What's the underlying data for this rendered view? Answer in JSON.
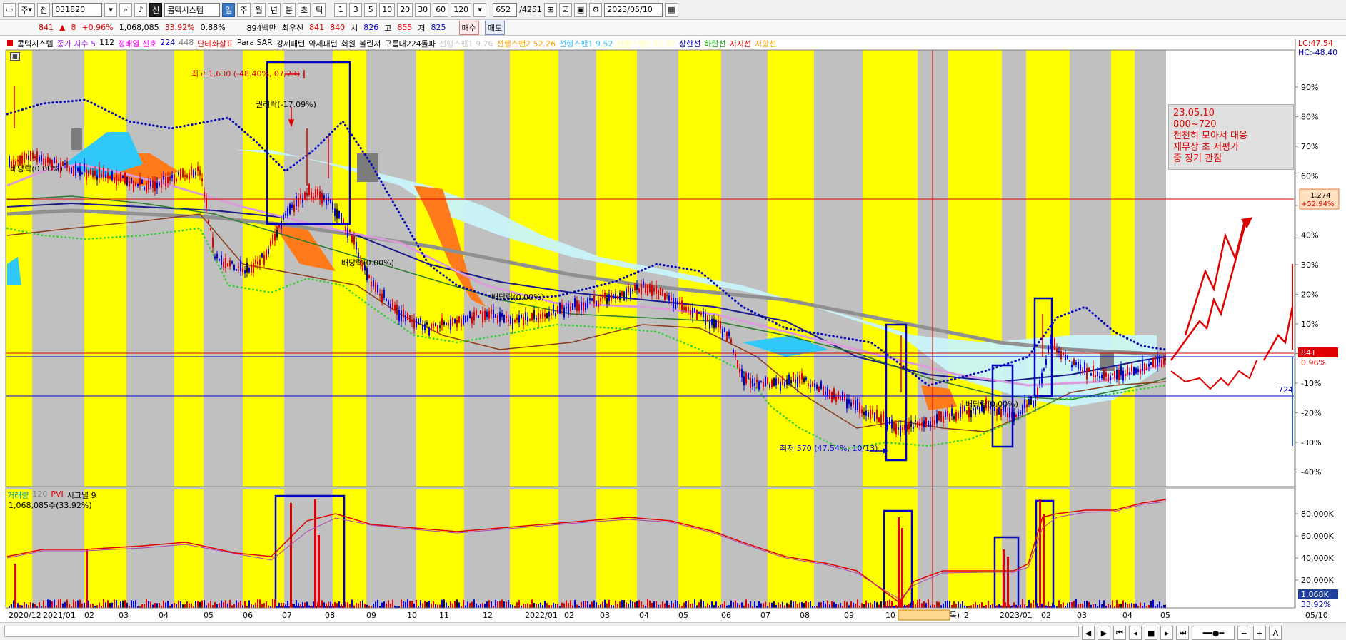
{
  "toolbar": {
    "period_type": "주",
    "jeon_label": "전",
    "code": "031820",
    "sin_label": "신",
    "stock_name": "콤텍시스템",
    "periods": [
      "일",
      "주",
      "월",
      "년",
      "분",
      "초",
      "틱"
    ],
    "active_period": "일",
    "numbers": [
      "1",
      "3",
      "5",
      "10",
      "20",
      "30",
      "60",
      "120"
    ],
    "count_value": "652",
    "count_total": "/4251",
    "date_value": "2023/05/10"
  },
  "quote": {
    "price": "841",
    "arrow": "▲",
    "change": "8",
    "change_pct": "+0.96%",
    "volume": "1,068,085",
    "vol_ratio": "33.92%",
    "turnover": "0.88%",
    "amount": "894백만",
    "best_label": "최우선",
    "best_ask": "841",
    "best_bid": "840",
    "open_label": "시",
    "open": "826",
    "high_label": "고",
    "high": "855",
    "low_label": "저",
    "low": "825",
    "buy_button": "매수",
    "sell_button": "매도"
  },
  "legend": [
    {
      "text": "콤텍시스템",
      "color": "#000000"
    },
    {
      "text": "종가 지수 5",
      "color": "#a020f0"
    },
    {
      "text": "112",
      "color": "#000000"
    },
    {
      "text": "정배열 신호",
      "color": "#ff00ff"
    },
    {
      "text": "224",
      "color": "#0000c0"
    },
    {
      "text": "448",
      "color": "#808080"
    },
    {
      "text": "단테화살표",
      "color": "#e00000"
    },
    {
      "text": "Para SAR",
      "color": "#000000"
    },
    {
      "text": "강세패턴",
      "color": "#000000"
    },
    {
      "text": "약세패턴",
      "color": "#000000"
    },
    {
      "text": "회원",
      "color": "#000000"
    },
    {
      "text": "볼린져",
      "color": "#000000"
    },
    {
      "text": "구름대224돌파",
      "color": "#000000"
    },
    {
      "text": "선행스팬1 9.26",
      "color": "#c8c8c8"
    },
    {
      "text": "선행스팬2 52.26",
      "color": "#ffa500"
    },
    {
      "text": "선행스팬1 9.52",
      "color": "#40c0ff"
    },
    {
      "text": "선행스팬2 52.52",
      "color": "#ffffa0"
    },
    {
      "text": "상한선",
      "color": "#0000c0"
    },
    {
      "text": "하한선",
      "color": "#00a000"
    },
    {
      "text": "지지선",
      "color": "#e00000"
    },
    {
      "text": "저항선",
      "color": "#ffa500"
    }
  ],
  "axis_top_labels": {
    "lc": "LC:47.54",
    "hc": "HC:-48.40"
  },
  "price_axis": [
    "90%",
    "80%",
    "70%",
    "60%",
    "50%",
    "40%",
    "30%",
    "20%",
    "10%",
    "0%",
    "-10%",
    "-20%",
    "-30%",
    "-40%"
  ],
  "price_tag": {
    "price": "841",
    "pct": "0.96%"
  },
  "resistance_tag": {
    "price": "1,274",
    "pct": "+52.94%"
  },
  "support_label": "724",
  "volume_axis": [
    "80,000K",
    "60,000K",
    "40,000K",
    "20,000K"
  ],
  "volume_tag": {
    "value": "1,068K",
    "pct": "33.92%"
  },
  "volume_legend": {
    "a": "거래량",
    "b": "120",
    "c": "PVI",
    "d": "시그널 9",
    "value": "1,068,085주(33.92%)"
  },
  "annotations": {
    "high": "최고 1,630 (-48.40%, 07/23)",
    "rights": "권리락(-17.09%)",
    "div1": "배당락(0.00%)",
    "div2": "배당락(0.00%)",
    "div3": "배당락(0.00%)",
    "div4": "배당락(0.00%)",
    "low": "최저 570 (47.54%, 10/13)"
  },
  "note": {
    "line1": "23.05.10",
    "line2": "800~720",
    "line3": "천천히 모아서 대응",
    "line4": "재무상 초 저평가",
    "line5": "중 장기 관점"
  },
  "time_axis": [
    "2020/12",
    "2021/01",
    "02",
    "03",
    "04",
    "05",
    "06",
    "07",
    "08",
    "09",
    "10",
    "11",
    "12",
    "2022/01",
    "02",
    "03",
    "04",
    "05",
    "06",
    "07",
    "08",
    "09",
    "10",
    "2022/11/10(목)",
    "2",
    "2023/01",
    "02",
    "03",
    "04",
    "05"
  ],
  "time_axis_end": "05/10",
  "colors": {
    "up": "#e00000",
    "down": "#0000e0",
    "yellow_band": "#ffff00",
    "gray_band": "#c0c0c0"
  }
}
